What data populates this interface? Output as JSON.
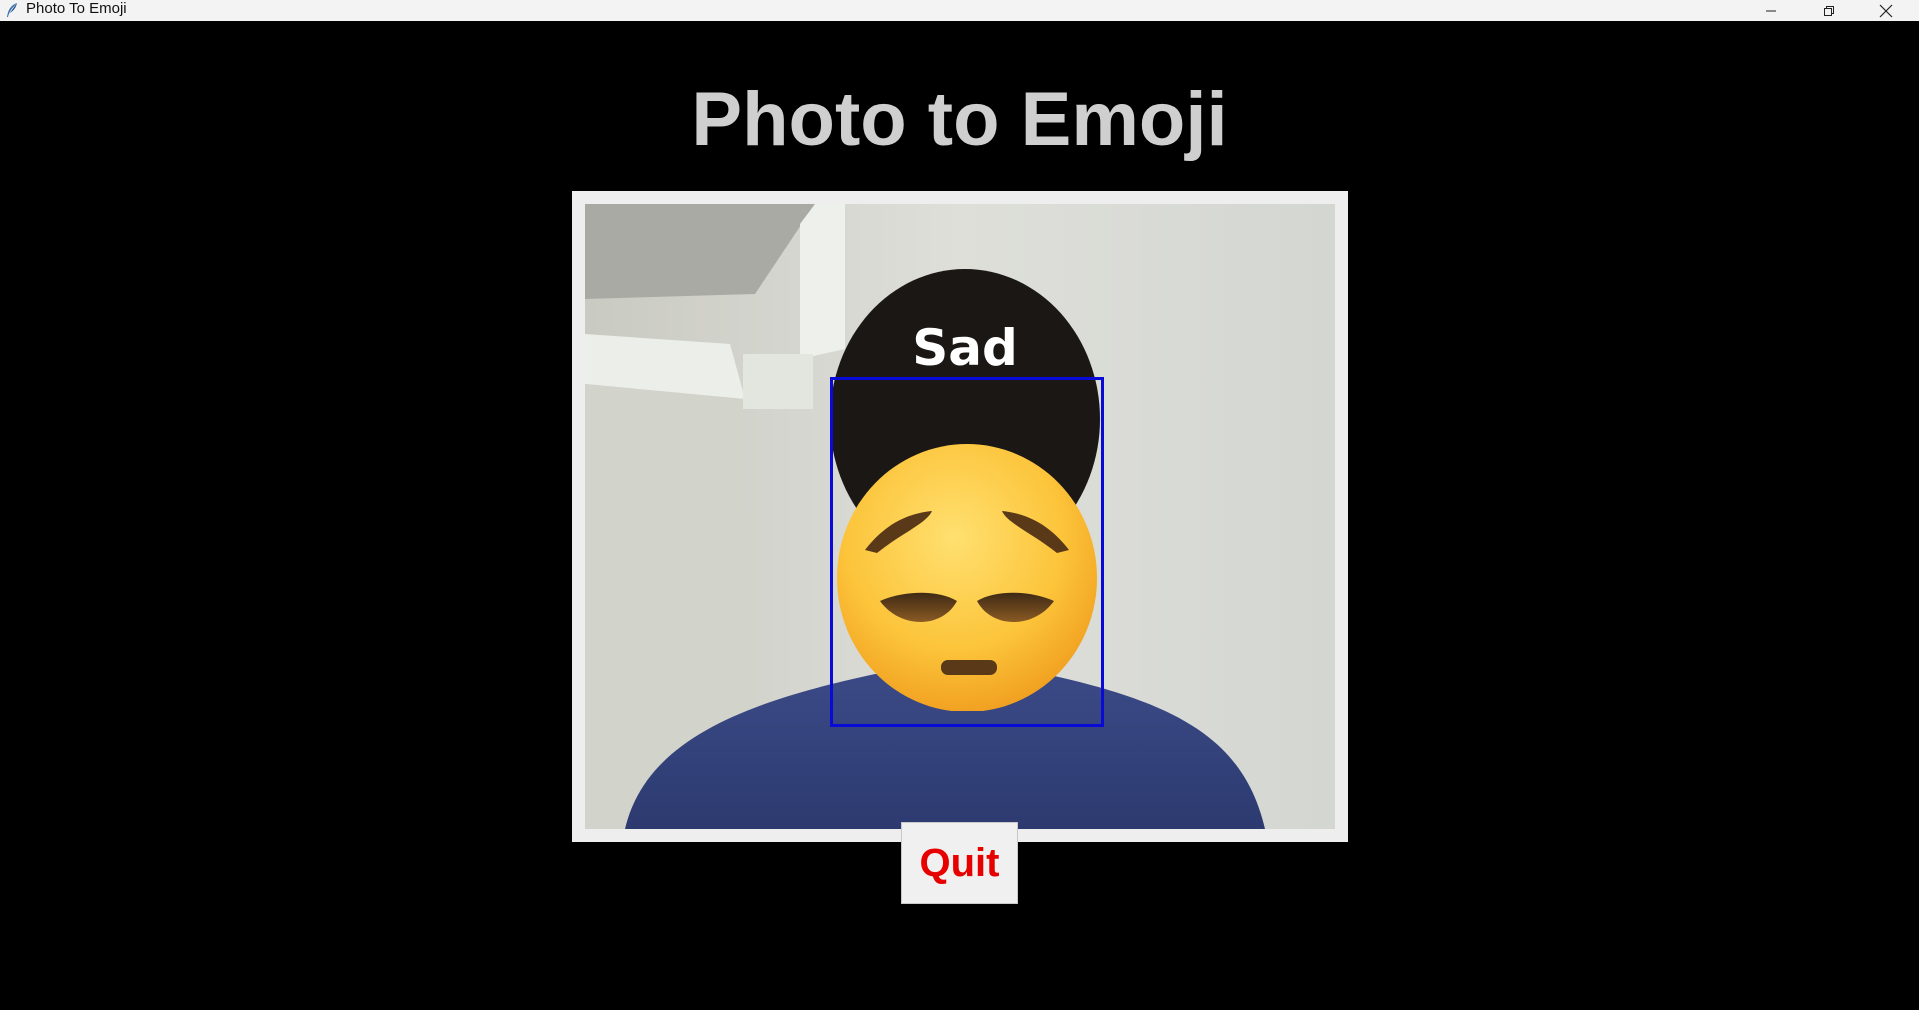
{
  "window": {
    "title": "Photo To Emoji",
    "icons": {
      "app": "feather-icon",
      "minimize": "minimize-icon",
      "maximize": "restore-icon",
      "close": "close-icon"
    }
  },
  "main": {
    "heading": "Photo to Emoji",
    "video": {
      "emotion_label": "Sad",
      "overlay_emoji": "pensive-face-emoji"
    },
    "quit_label": "Quit"
  },
  "colors": {
    "background": "#000000",
    "heading": "#cfcfcf",
    "frame": "#eeeeee",
    "face_box": "#0a0ad8",
    "quit_text": "#e60000"
  }
}
